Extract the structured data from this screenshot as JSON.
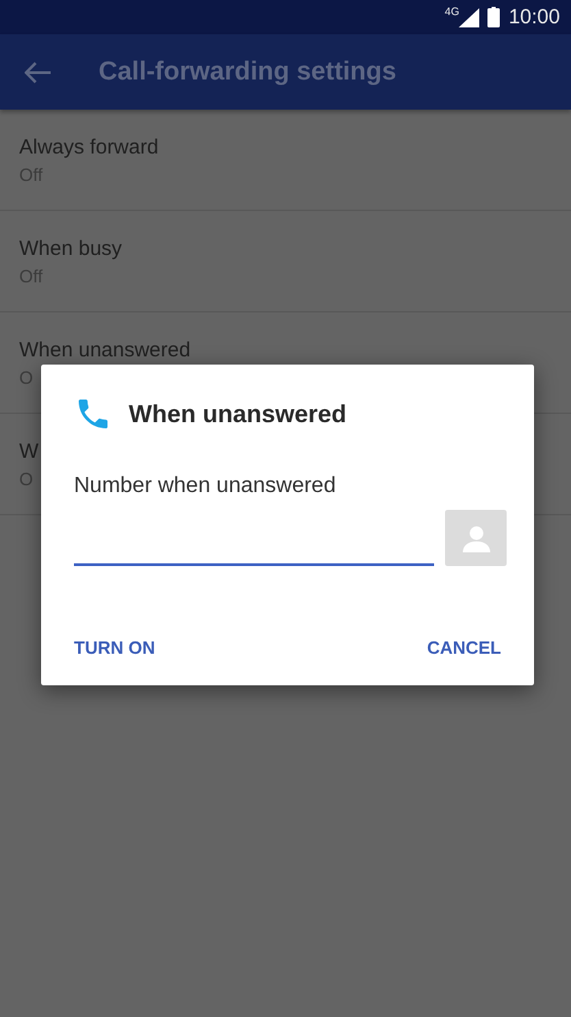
{
  "status_bar": {
    "network": "4G",
    "time": "10:00"
  },
  "app_bar": {
    "title": "Call-forwarding settings"
  },
  "settings": [
    {
      "title": "Always forward",
      "status": "Off"
    },
    {
      "title": "When busy",
      "status": "Off"
    },
    {
      "title": "When unanswered",
      "status": "O"
    },
    {
      "title": "W",
      "status": "O"
    }
  ],
  "dialog": {
    "title": "When unanswered",
    "label": "Number when unanswered",
    "buttons": [
      "TURN ON",
      "CANCEL"
    ]
  }
}
